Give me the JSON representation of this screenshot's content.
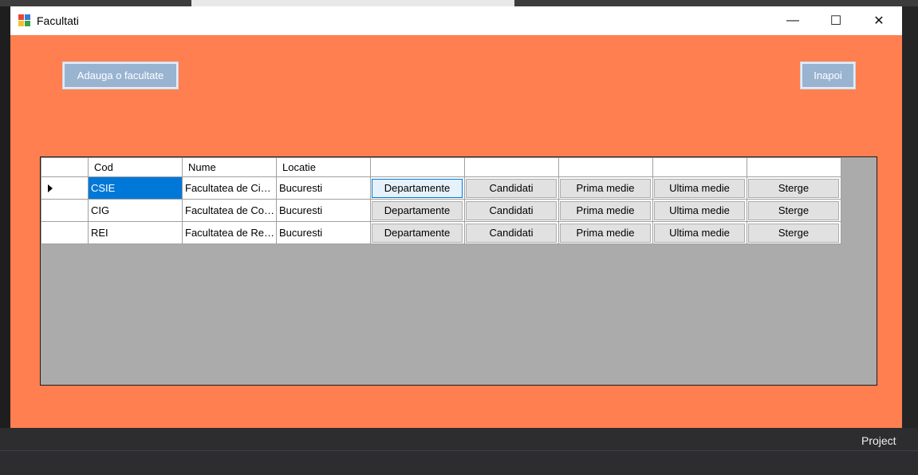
{
  "window": {
    "title": "Facultati",
    "controls": {
      "minimize": "—",
      "maximize": "☐",
      "close": "✕"
    }
  },
  "toolbar": {
    "add_label": "Adauga o facultate",
    "back_label": "Inapoi"
  },
  "table": {
    "columns": [
      "Cod",
      "Nume",
      "Locatie",
      "",
      "",
      "",
      "",
      ""
    ],
    "rows": [
      {
        "cod": "CSIE",
        "nume": "Facultatea de Cibernetica",
        "locatie": "Bucuresti",
        "selected": true
      },
      {
        "cod": "CIG",
        "nume": "Facultatea de Contabilitate",
        "locatie": "Bucuresti",
        "selected": false
      },
      {
        "cod": "REI",
        "nume": "Facultatea de Relatii",
        "locatie": "Bucuresti",
        "selected": false
      }
    ],
    "row_buttons": [
      "Departamente",
      "Candidati",
      "Prima medie",
      "Ultima medie",
      "Sterge"
    ]
  },
  "ide": {
    "project_label": "Project"
  },
  "colors": {
    "form_background": "#ff7f50",
    "grid_background": "#ababab",
    "selection": "#0078d7",
    "disabled_button": "#99b4d1"
  }
}
